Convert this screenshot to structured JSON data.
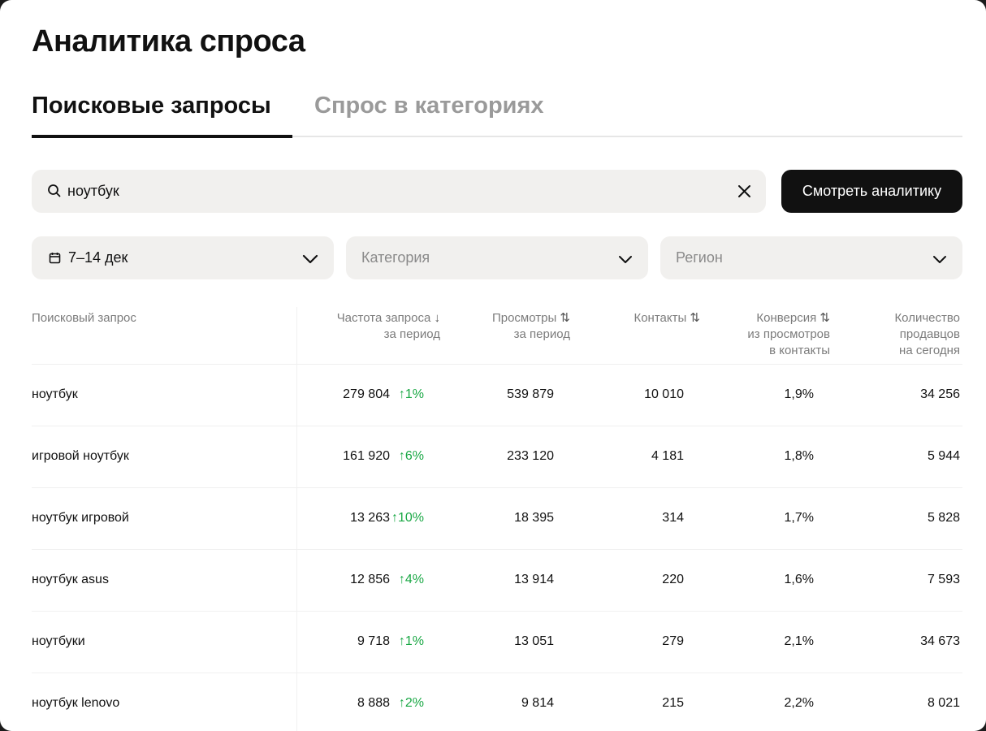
{
  "page": {
    "title": "Аналитика спроса"
  },
  "tabs": [
    {
      "label": "Поисковые запросы",
      "active": true
    },
    {
      "label": "Спрос в категориях",
      "active": false
    }
  ],
  "search": {
    "value": "ноутбук",
    "icon": "search-icon",
    "clear_icon": "close-icon"
  },
  "actions": {
    "view_analytics": "Смотреть аналитику"
  },
  "filters": {
    "date": {
      "value": "7–14 дек",
      "icon": "calendar-icon"
    },
    "category": {
      "placeholder": "Категория"
    },
    "region": {
      "placeholder": "Регион"
    }
  },
  "table": {
    "headers": {
      "query": "Поисковый запрос",
      "frequency": [
        "Частота запроса",
        "за период"
      ],
      "frequency_sort": "↓",
      "views": [
        "Просмотры",
        "за период"
      ],
      "views_sort": "⇅",
      "contacts": "Контакты",
      "contacts_sort": "⇅",
      "conversion": [
        "Конверсия",
        "из просмотров",
        "в контакты"
      ],
      "conversion_sort": "⇅",
      "sellers": [
        "Количество",
        "продавцов",
        "на сегодня"
      ]
    },
    "rows": [
      {
        "query": "ноутбук",
        "frequency": "279 804",
        "growth": "↑1%",
        "views": "539 879",
        "contacts": "10 010",
        "conversion": "1,9%",
        "sellers": "34 256"
      },
      {
        "query": "игровой ноутбук",
        "frequency": "161 920",
        "growth": "↑6%",
        "views": "233 120",
        "contacts": "4 181",
        "conversion": "1,8%",
        "sellers": "5 944"
      },
      {
        "query": "ноутбук игровой",
        "frequency": "13 263",
        "growth": "↑10%",
        "views": "18 395",
        "contacts": "314",
        "conversion": "1,7%",
        "sellers": "5 828"
      },
      {
        "query": "ноутбук asus",
        "frequency": "12 856",
        "growth": "↑4%",
        "views": "13 914",
        "contacts": "220",
        "conversion": "1,6%",
        "sellers": "7 593"
      },
      {
        "query": "ноутбуки",
        "frequency": "9 718",
        "growth": "↑1%",
        "views": "13 051",
        "contacts": "279",
        "conversion": "2,1%",
        "sellers": "34 673"
      },
      {
        "query": "ноутбук lenovo",
        "frequency": "8 888",
        "growth": "↑2%",
        "views": "9 814",
        "contacts": "215",
        "conversion": "2,2%",
        "sellers": "8 021"
      }
    ]
  },
  "colors": {
    "growth": "#1aa845",
    "primary_button": "#111111",
    "field_bg": "#f1f0ee"
  }
}
